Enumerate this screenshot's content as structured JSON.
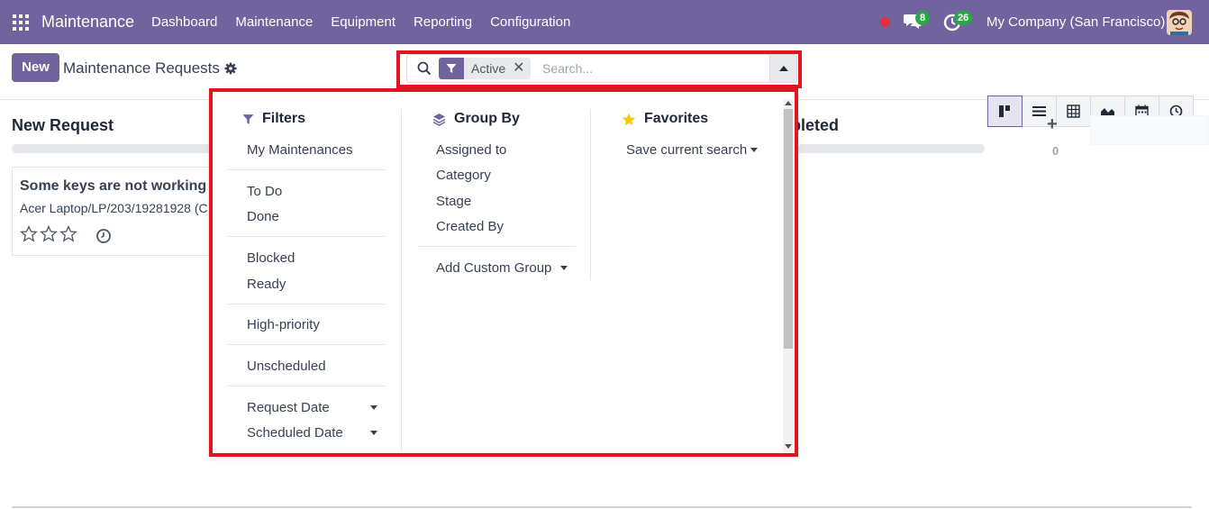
{
  "nav": {
    "app_name": "Maintenance",
    "menu": [
      "Dashboard",
      "Maintenance",
      "Equipment",
      "Reporting",
      "Configuration"
    ],
    "messages_count": "8",
    "activities_count": "26",
    "company": "My Company (San Francisco)"
  },
  "control": {
    "new_label": "New",
    "title": "Maintenance Requests",
    "search": {
      "facet_value": "Active",
      "facet_remove": "✕",
      "placeholder": "Search..."
    }
  },
  "views": [
    "kanban-view-icon",
    "list-view-icon",
    "pivot-view-icon",
    "graph-view-icon",
    "calendar-view-icon",
    "activity-view-icon"
  ],
  "kanban": {
    "col1_title": "New Request",
    "col2_title_partial": "pleted",
    "col2_count": "0",
    "add_col": "+",
    "card": {
      "title": "Some keys are not working",
      "subtitle": "Acer Laptop/LP/203/19281928 (C"
    }
  },
  "dropdown": {
    "filters": {
      "heading": "Filters",
      "items": [
        "My Maintenances",
        "To Do",
        "Done",
        "Blocked",
        "Ready",
        "High-priority",
        "Unscheduled",
        "Request Date",
        "Scheduled Date"
      ]
    },
    "groupby": {
      "heading": "Group By",
      "items": [
        "Assigned to",
        "Category",
        "Stage",
        "Created By",
        "Add Custom Group"
      ]
    },
    "favorites": {
      "heading": "Favorites",
      "items": [
        "Save current search"
      ]
    }
  },
  "colors": {
    "brand": "#71639e",
    "highlight": "#e3141f",
    "badge": "#28a745",
    "star": "#f3cc00"
  }
}
